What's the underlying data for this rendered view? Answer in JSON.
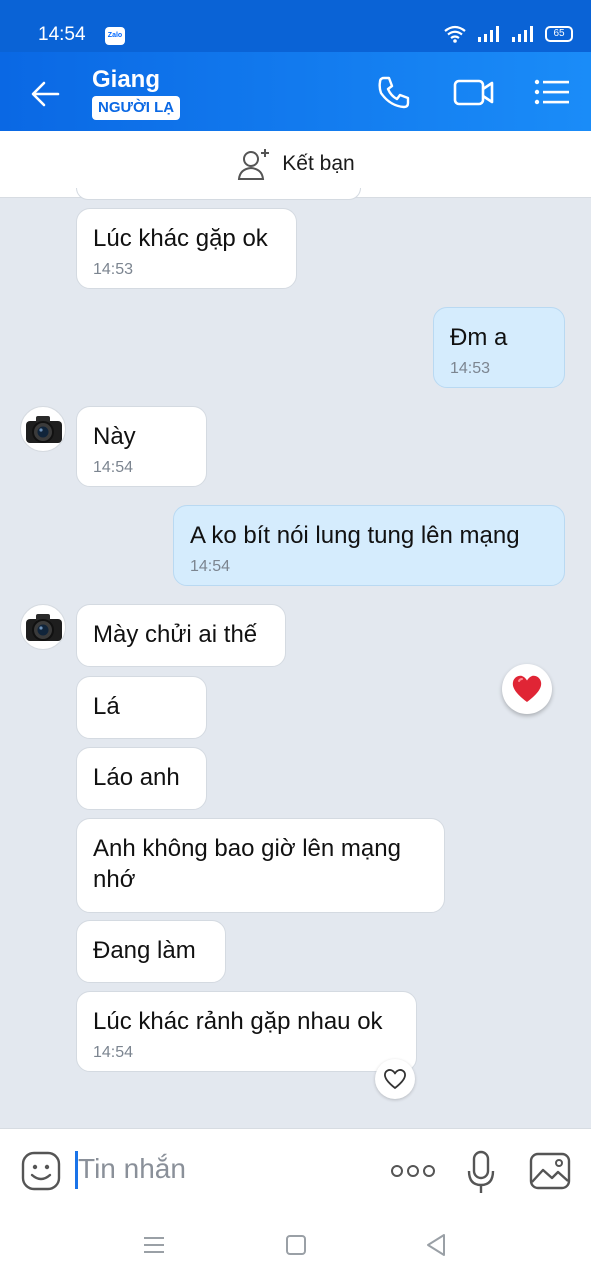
{
  "status": {
    "time": "14:54",
    "battery": "65"
  },
  "header": {
    "name": "Giang",
    "badge": "NGƯỜI LẠ"
  },
  "add_friend": {
    "label": "Kết bạn"
  },
  "messages": [
    {
      "text": "Lúc khác gặp ok",
      "time": "14:53"
    },
    {
      "text": "Đm a",
      "time": "14:53"
    },
    {
      "text": "Này",
      "time": "14:54"
    },
    {
      "text": "A ko bít nói lung tung lên mạng",
      "time": "14:54"
    },
    {
      "text": "Mày chửi ai thế"
    },
    {
      "text": "Lá"
    },
    {
      "text": "Láo anh"
    },
    {
      "text": "Anh không bao giờ lên mạng nhớ"
    },
    {
      "text": "Đang làm"
    },
    {
      "text": "Lúc khác rảnh gặp nhau ok",
      "time": "14:54"
    }
  ],
  "composer": {
    "placeholder": "Tin nhắn"
  },
  "icons": {
    "back": "arrow-left-icon",
    "call": "phone-icon",
    "video": "video-camera-icon",
    "menu": "list-icon",
    "add_friend": "user-plus-icon",
    "sticker": "emoji-icon",
    "more": "more-dots-icon",
    "mic": "microphone-icon",
    "image": "image-icon",
    "reaction": "heart-icon"
  },
  "colors": {
    "header": "#0a68e4",
    "outgoing": "#d5ecfd",
    "incoming": "#ffffff",
    "reaction": "#e02535"
  }
}
